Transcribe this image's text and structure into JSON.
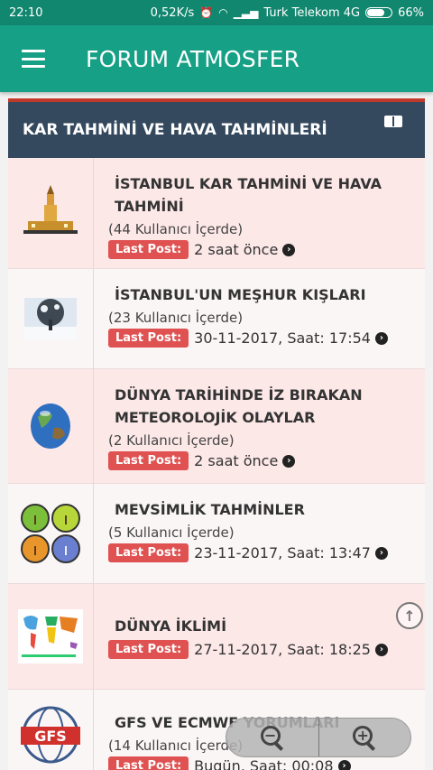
{
  "status_bar": {
    "time": "22:10",
    "speed": "0,52K/s",
    "carrier": "Turk Telekom 4G",
    "battery": "66%",
    "battery_level": 0.66
  },
  "app": {
    "title": "FORUM ATMOSFER",
    "accent_color": "#16a085",
    "header_color": "#34495e",
    "badge_color": "#e05252"
  },
  "section": {
    "title": "KAR TAHMİNİ VE HAVA TAHMİNLERİ"
  },
  "forums": [
    {
      "title": "İSTANBUL KAR TAHMİNİ VE HAVA TAHMİNİ",
      "users": "(44 Kullanıcı İçerde)",
      "last_post_label": "Last Post:",
      "last_post_time": "2 saat önce",
      "icon": "maiden-tower-icon"
    },
    {
      "title": "İSTANBUL'UN MEŞHUR KIŞLARI",
      "users": "(23 Kullanıcı İçerde)",
      "last_post_label": "Last Post:",
      "last_post_time": "30-11-2017, Saat: 17:54",
      "icon": "snowy-tree-icon"
    },
    {
      "title": "DÜNYA TARİHİNDE İZ BIRAKAN METEOROLOJİK OLAYLAR",
      "users": "(2 Kullanıcı İçerde)",
      "last_post_label": "Last Post:",
      "last_post_time": "2 saat önce",
      "icon": "globe-icon"
    },
    {
      "title": "MEVSİMLİK TAHMİNLER",
      "users": "(5 Kullanıcı İçerde)",
      "last_post_label": "Last Post:",
      "last_post_time": "23-11-2017, Saat: 13:47",
      "icon": "four-seasons-icon"
    },
    {
      "title": "DÜNYA İKLİMİ",
      "users": "",
      "last_post_label": "Last Post:",
      "last_post_time": "27-11-2017, Saat: 18:25",
      "icon": "climate-map-icon"
    },
    {
      "title": "GFS VE ECMWF YORUMLARI",
      "users": "(14 Kullanıcı İçerde)",
      "last_post_label": "Last Post:",
      "last_post_time": "Bugün, Saat: 00:08",
      "icon": "gfs-logo-icon",
      "logo_text": "GFS"
    }
  ]
}
